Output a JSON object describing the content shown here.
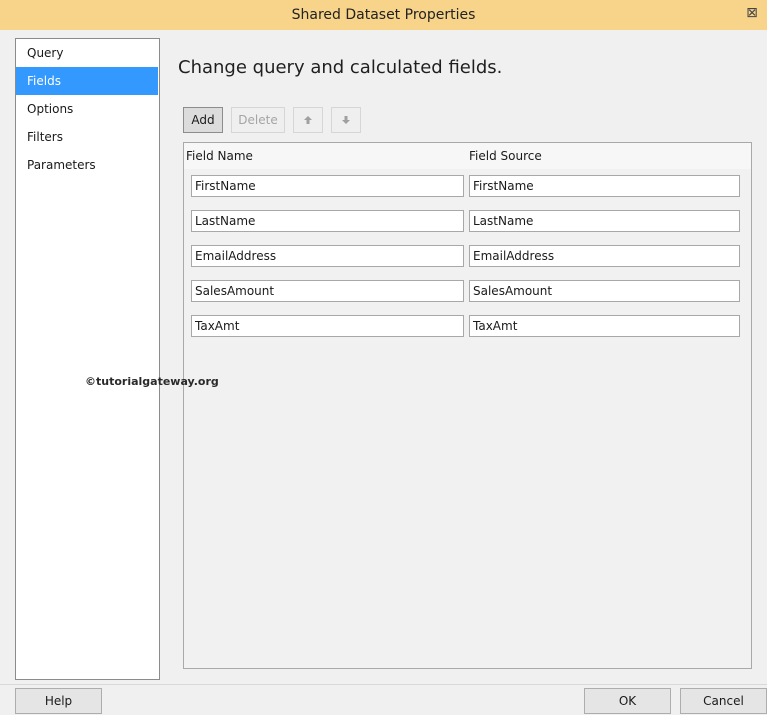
{
  "window": {
    "title": "Shared Dataset Properties",
    "close_glyph": "⊠"
  },
  "sidebar": {
    "items": [
      {
        "label": "Query"
      },
      {
        "label": "Fields",
        "selected": true
      },
      {
        "label": "Options"
      },
      {
        "label": "Filters"
      },
      {
        "label": "Parameters"
      }
    ]
  },
  "main": {
    "heading": "Change query and calculated fields."
  },
  "toolbar": {
    "add_label": "Add",
    "delete_label": "Delete",
    "up_icon": "arrow-up-icon",
    "down_icon": "arrow-down-icon"
  },
  "grid": {
    "col_name": "Field Name",
    "col_source": "Field Source",
    "rows": [
      {
        "name": "FirstName",
        "source": "FirstName"
      },
      {
        "name": "LastName",
        "source": "LastName"
      },
      {
        "name": "EmailAddress",
        "source": "EmailAddress"
      },
      {
        "name": "SalesAmount",
        "source": "SalesAmount"
      },
      {
        "name": "TaxAmt",
        "source": "TaxAmt"
      }
    ]
  },
  "watermark": "©tutorialgateway.org",
  "footer": {
    "help_label": "Help",
    "ok_label": "OK",
    "cancel_label": "Cancel"
  },
  "colors": {
    "titlebar": "#f7d489",
    "selection": "#3399ff"
  }
}
